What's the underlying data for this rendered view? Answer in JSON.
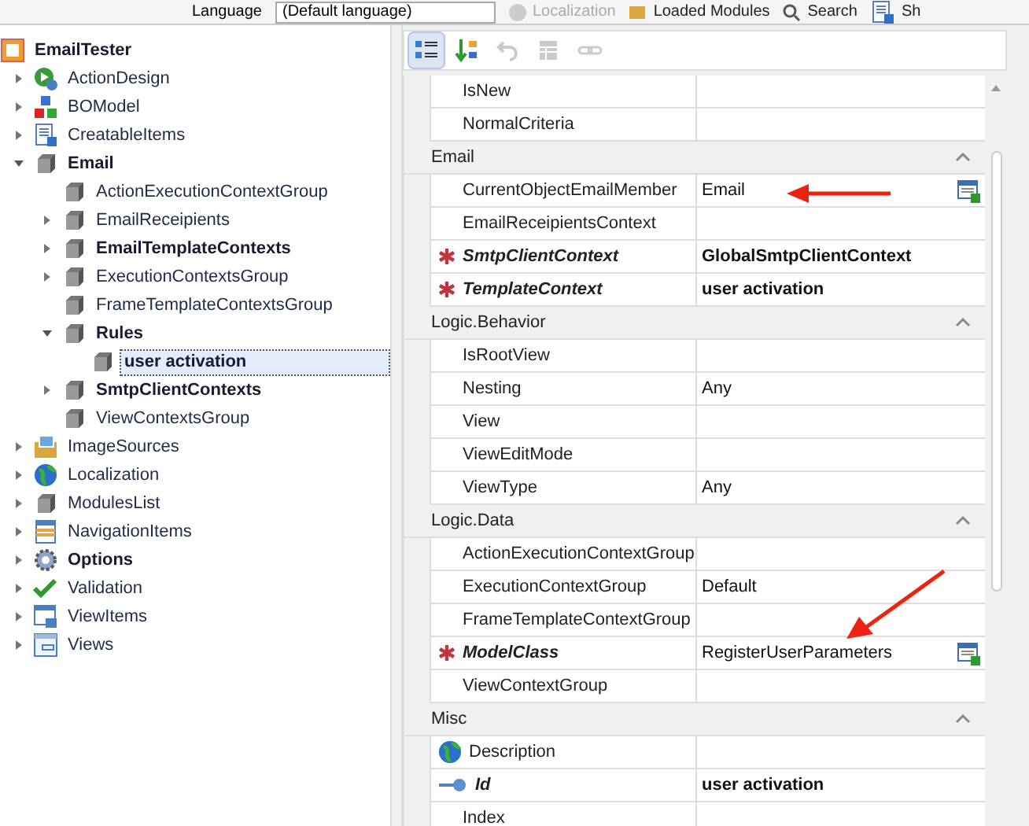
{
  "top_toolbar": {
    "language_label": "Language",
    "language_value": "(Default language)",
    "items": [
      {
        "label": "Localization",
        "disabled": true,
        "kind": "circle"
      },
      {
        "label": "Loaded Modules",
        "disabled": false,
        "kind": "modules"
      },
      {
        "label": "Search",
        "disabled": false,
        "kind": "search"
      },
      {
        "label": "Sh",
        "disabled": false,
        "kind": "doc"
      }
    ]
  },
  "tree": [
    {
      "label": "EmailTester",
      "bold": true,
      "kind": "app",
      "children": [
        {
          "label": "ActionDesign",
          "bold": false,
          "kind": "action",
          "expanded": false
        },
        {
          "label": "BOModel",
          "bold": false,
          "kind": "blocks",
          "expanded": false
        },
        {
          "label": "CreatableItems",
          "bold": false,
          "kind": "doc",
          "expanded": false
        },
        {
          "label": "Email",
          "bold": true,
          "kind": "cube",
          "expanded": true,
          "children": [
            {
              "label": "ActionExecutionContextGroup",
              "bold": false,
              "kind": "cube"
            },
            {
              "label": "EmailReceipients",
              "bold": false,
              "kind": "cube",
              "expanded": false
            },
            {
              "label": "EmailTemplateContexts",
              "bold": true,
              "kind": "cube",
              "expanded": false
            },
            {
              "label": "ExecutionContextsGroup",
              "bold": false,
              "kind": "cube",
              "expanded": false
            },
            {
              "label": "FrameTemplateContextsGroup",
              "bold": false,
              "kind": "cube"
            },
            {
              "label": "Rules",
              "bold": true,
              "kind": "cube",
              "expanded": true,
              "children": [
                {
                  "label": "user activation",
                  "bold": true,
                  "kind": "cube",
                  "selected": true
                }
              ]
            },
            {
              "label": "SmtpClientContexts",
              "bold": true,
              "kind": "cube",
              "expanded": false
            },
            {
              "label": "ViewContextsGroup",
              "bold": false,
              "kind": "cube"
            }
          ]
        },
        {
          "label": "ImageSources",
          "bold": false,
          "kind": "image",
          "expanded": false
        },
        {
          "label": "Localization",
          "bold": false,
          "kind": "globe",
          "expanded": false
        },
        {
          "label": "ModulesList",
          "bold": false,
          "kind": "cube",
          "expanded": false
        },
        {
          "label": "NavigationItems",
          "bold": false,
          "kind": "list",
          "expanded": false
        },
        {
          "label": "Options",
          "bold": true,
          "kind": "gear",
          "expanded": false
        },
        {
          "label": "Validation",
          "bold": false,
          "kind": "check",
          "expanded": false
        },
        {
          "label": "ViewItems",
          "bold": false,
          "kind": "window",
          "expanded": false
        },
        {
          "label": "Views",
          "bold": false,
          "kind": "views",
          "expanded": false
        }
      ]
    }
  ],
  "grid_toolbar": [
    {
      "kind": "categorized",
      "selected": true,
      "disabled": false
    },
    {
      "kind": "alphabetical",
      "selected": false,
      "disabled": false
    },
    {
      "kind": "undo",
      "selected": false,
      "disabled": true
    },
    {
      "kind": "grid",
      "selected": false,
      "disabled": true
    },
    {
      "kind": "link",
      "selected": false,
      "disabled": true
    }
  ],
  "categories": [
    {
      "rows": [
        {
          "name": "IsNew"
        },
        {
          "name": "NormalCriteria"
        }
      ]
    },
    {
      "name": "Email",
      "expanded": true,
      "rows": [
        {
          "name": "CurrentObjectEmailMember",
          "value": "Email",
          "editor_button": true
        },
        {
          "name": "EmailReceipientsContext"
        },
        {
          "name": "SmtpClientContext",
          "value": "GlobalSmtpClientContext",
          "required": true,
          "bold": true,
          "value_bold": true
        },
        {
          "name": "TemplateContext",
          "value": "user activation",
          "required": true,
          "bold": true,
          "value_bold": true
        }
      ]
    },
    {
      "name": "Logic.Behavior",
      "expanded": true,
      "rows": [
        {
          "name": "IsRootView"
        },
        {
          "name": "Nesting",
          "value": "Any"
        },
        {
          "name": "View"
        },
        {
          "name": "ViewEditMode"
        },
        {
          "name": "ViewType",
          "value": "Any"
        }
      ]
    },
    {
      "name": "Logic.Data",
      "expanded": true,
      "rows": [
        {
          "name": "ActionExecutionContextGroup"
        },
        {
          "name": "ExecutionContextGroup",
          "value": "Default"
        },
        {
          "name": "FrameTemplateContextGroup"
        },
        {
          "name": "ModelClass",
          "value": "RegisterUserParameters",
          "required": true,
          "bold": true,
          "editor_button": true
        },
        {
          "name": "ViewContextGroup"
        }
      ]
    },
    {
      "name": "Misc",
      "expanded": true,
      "rows": [
        {
          "name": "Description",
          "kind": "globe"
        },
        {
          "name": "Id",
          "value": "user activation",
          "bold": true,
          "value_bold": true,
          "kind": "key"
        },
        {
          "name": "Index"
        }
      ]
    }
  ]
}
